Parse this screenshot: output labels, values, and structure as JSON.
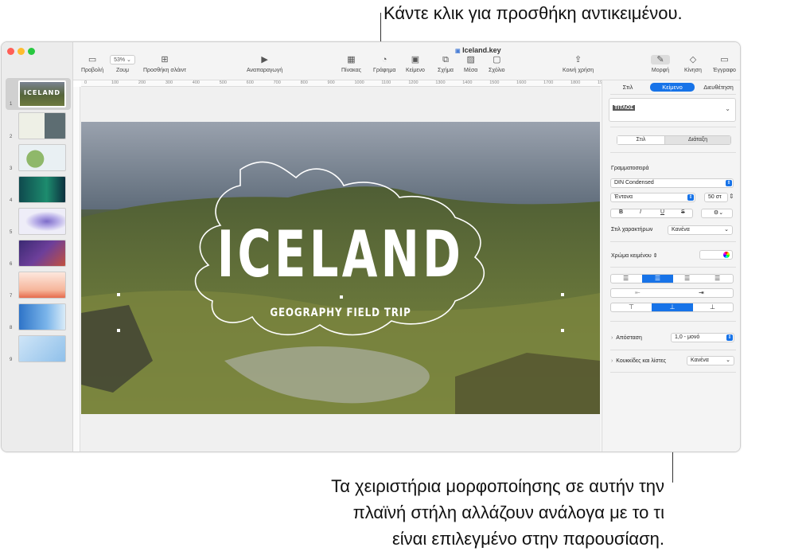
{
  "callouts": {
    "top": "Κάντε κλικ για προσθήκη αντικειμένου.",
    "bottom": [
      "Τα χειριστήρια μορφοποίησης σε αυτήν την",
      "πλαϊνή στήλη αλλάζουν ανάλογα με το τι",
      "είναι επιλεγμένο στην παρουσίαση."
    ]
  },
  "window": {
    "title": "Iceland.key"
  },
  "toolbar": {
    "view": "Προβολή",
    "zoom_value": "53%",
    "zoom": "Ζουμ",
    "add_slide": "Προσθήκη σλάιντ",
    "play": "Αναπαραγωγή",
    "table": "Πίνακας",
    "chart": "Γράφημα",
    "text": "Κείμενο",
    "shape": "Σχήμα",
    "media": "Μέσα",
    "comment": "Σχόλιο",
    "share": "Κοινή χρήση",
    "format": "Μορφή",
    "animate": "Κίνηση",
    "document": "Έγγραφο"
  },
  "ruler": [
    "0",
    "100",
    "200",
    "300",
    "400",
    "500",
    "600",
    "700",
    "800",
    "900",
    "1000",
    "1100",
    "1200",
    "1300",
    "1400",
    "1500",
    "1600",
    "1700",
    "1800",
    "1900"
  ],
  "slides": [
    "1",
    "2",
    "3",
    "4",
    "5",
    "6",
    "7",
    "8",
    "9"
  ],
  "slide": {
    "title": "ICELAND",
    "subtitle": "GEOGRAPHY FIELD TRIP",
    "thumb1_title": "ICELAND"
  },
  "panel": {
    "tabs": [
      "Στιλ",
      "Κείμενο",
      "Διευθέτηση"
    ],
    "style_preview": "ΤΙΤΛΟΣ",
    "subtabs": [
      "Στιλ",
      "Διάταξη"
    ],
    "font_label": "Γραμματοσειρά",
    "font_name": "DIN Condensed",
    "font_weight": "Έντονα",
    "font_size": "50 στ",
    "bold": "B",
    "italic": "I",
    "underline": "U",
    "strike": "S",
    "char_style_label": "Στιλ χαρακτήρων",
    "char_style_value": "Κανένα",
    "text_color_label": "Χρώμα κειμένου",
    "spacing_label": "Απόσταση",
    "spacing_value": "1,0 - μονό",
    "bullets_label": "Κουκκίδες και λίστες",
    "bullets_value": "Κανένα"
  }
}
